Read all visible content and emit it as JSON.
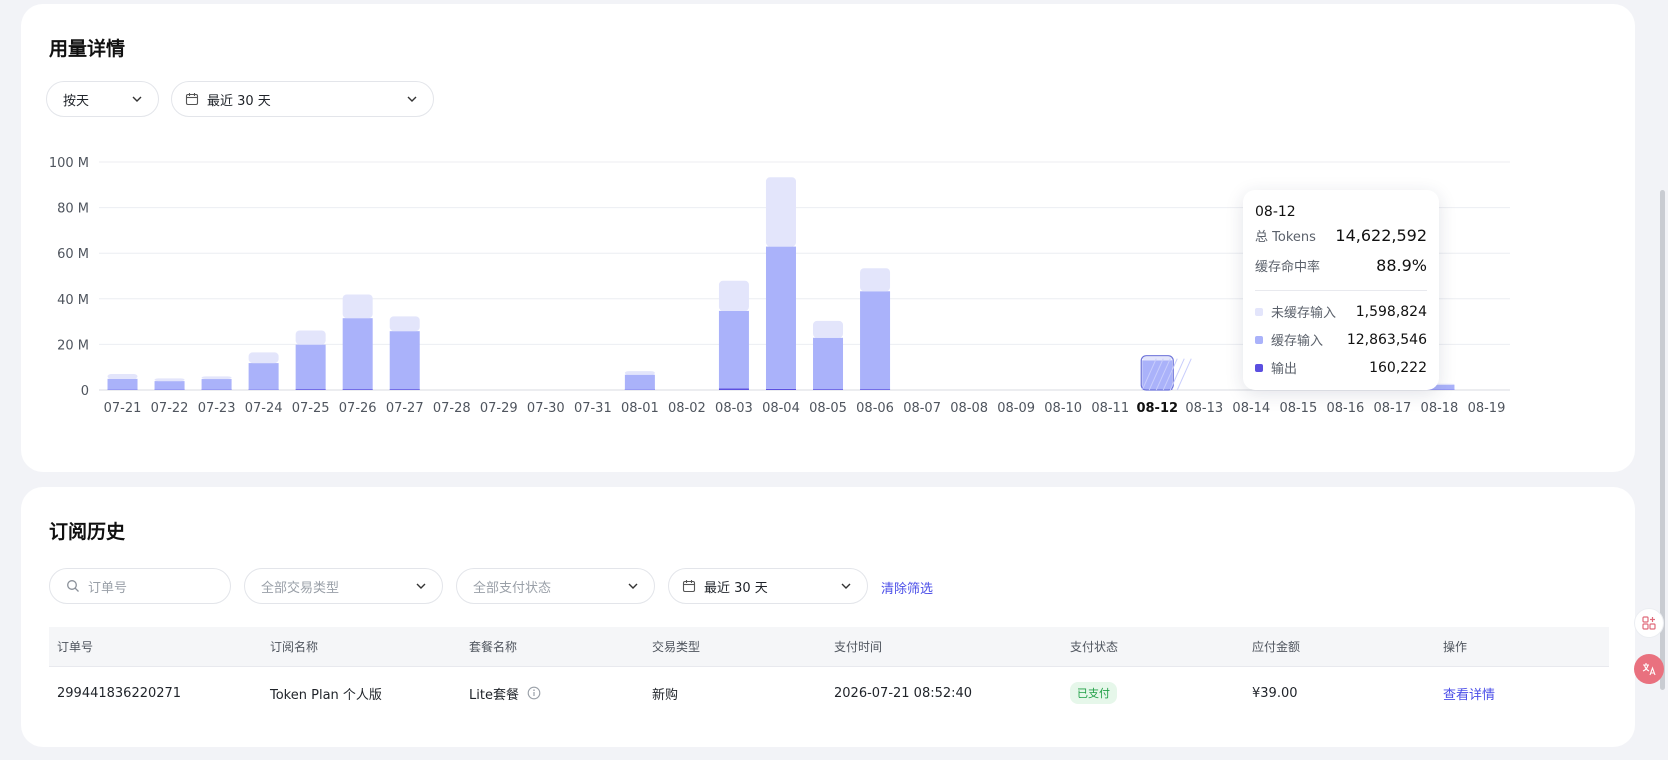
{
  "usage": {
    "title": "用量详情",
    "granularity": "按天",
    "date_range": "最近 30 天"
  },
  "chart_data": {
    "type": "bar",
    "stacked": true,
    "y_ticks": [
      "100 M",
      "80 M",
      "60 M",
      "40 M",
      "20 M",
      "0"
    ],
    "ylim": [
      0,
      100
    ],
    "grid": true,
    "categories": [
      "07-21",
      "07-22",
      "07-23",
      "07-24",
      "07-25",
      "07-26",
      "07-27",
      "07-28",
      "07-29",
      "07-30",
      "07-31",
      "08-01",
      "08-02",
      "08-03",
      "08-04",
      "08-05",
      "08-06",
      "08-07",
      "08-08",
      "08-09",
      "08-10",
      "08-11",
      "08-12",
      "08-13",
      "08-14",
      "08-15",
      "08-16",
      "08-17",
      "08-18",
      "08-19"
    ],
    "highlight": "08-12",
    "series": [
      {
        "name": "输出",
        "color": "#5b4fe0",
        "values": [
          0.1,
          0.1,
          0.1,
          0.1,
          0.3,
          0.3,
          0.3,
          0,
          0,
          0,
          0,
          0.1,
          0,
          0.7,
          0.5,
          0.3,
          0.3,
          0,
          0,
          0,
          0,
          0,
          0.16,
          0,
          0,
          0,
          0,
          0,
          0.1,
          0
        ]
      },
      {
        "name": "缓存输入",
        "color": "#aab2fa",
        "values": [
          4.8,
          3.8,
          4.7,
          11.7,
          19.6,
          31.2,
          25.5,
          0,
          0,
          0,
          0,
          6.6,
          0,
          34,
          62.4,
          22.6,
          43,
          0,
          0,
          0,
          0,
          0,
          12.86,
          0,
          0,
          0,
          0,
          0,
          2.2,
          0
        ]
      },
      {
        "name": "未缓存输入",
        "color": "#e3e5fb",
        "values": [
          2.1,
          1.2,
          1.2,
          4.7,
          6.2,
          10.4,
          6.5,
          0,
          0,
          0,
          0,
          1.6,
          0,
          13.2,
          30.4,
          7.4,
          10.1,
          0,
          0,
          0,
          0,
          0,
          1.6,
          0,
          0,
          0,
          0,
          0,
          0.4,
          0
        ]
      }
    ]
  },
  "tooltip": {
    "date": "08-12",
    "total_label": "总 Tokens",
    "total_value": "14,622,592",
    "cache_rate_label": "缓存命中率",
    "cache_rate_value": "88.9%",
    "uncached_label": "未缓存输入",
    "uncached_value": "1,598,824",
    "cached_label": "缓存输入",
    "cached_value": "12,863,546",
    "output_label": "输出",
    "output_value": "160,222",
    "colors": {
      "uncached": "#e3e5fb",
      "cached": "#aab2fa",
      "output": "#5b4fe0"
    }
  },
  "history": {
    "title": "订阅历史",
    "search_placeholder": "订单号",
    "filter_type": "全部交易类型",
    "filter_status": "全部支付状态",
    "date_range": "最近 30 天",
    "clear_filters": "清除筛选",
    "columns": [
      "订单号",
      "订阅名称",
      "套餐名称",
      "交易类型",
      "支付时间",
      "支付状态",
      "应付金额",
      "操作"
    ],
    "rows": [
      {
        "order_no": "299441836220271",
        "subscription": "Token Plan 个人版",
        "plan": "Lite套餐",
        "type": "新购",
        "time": "2026-07-21 08:52:40",
        "status": "已支付",
        "amount": "¥39.00",
        "action": "查看详情"
      }
    ]
  },
  "accent_color": "#4b4ee8"
}
